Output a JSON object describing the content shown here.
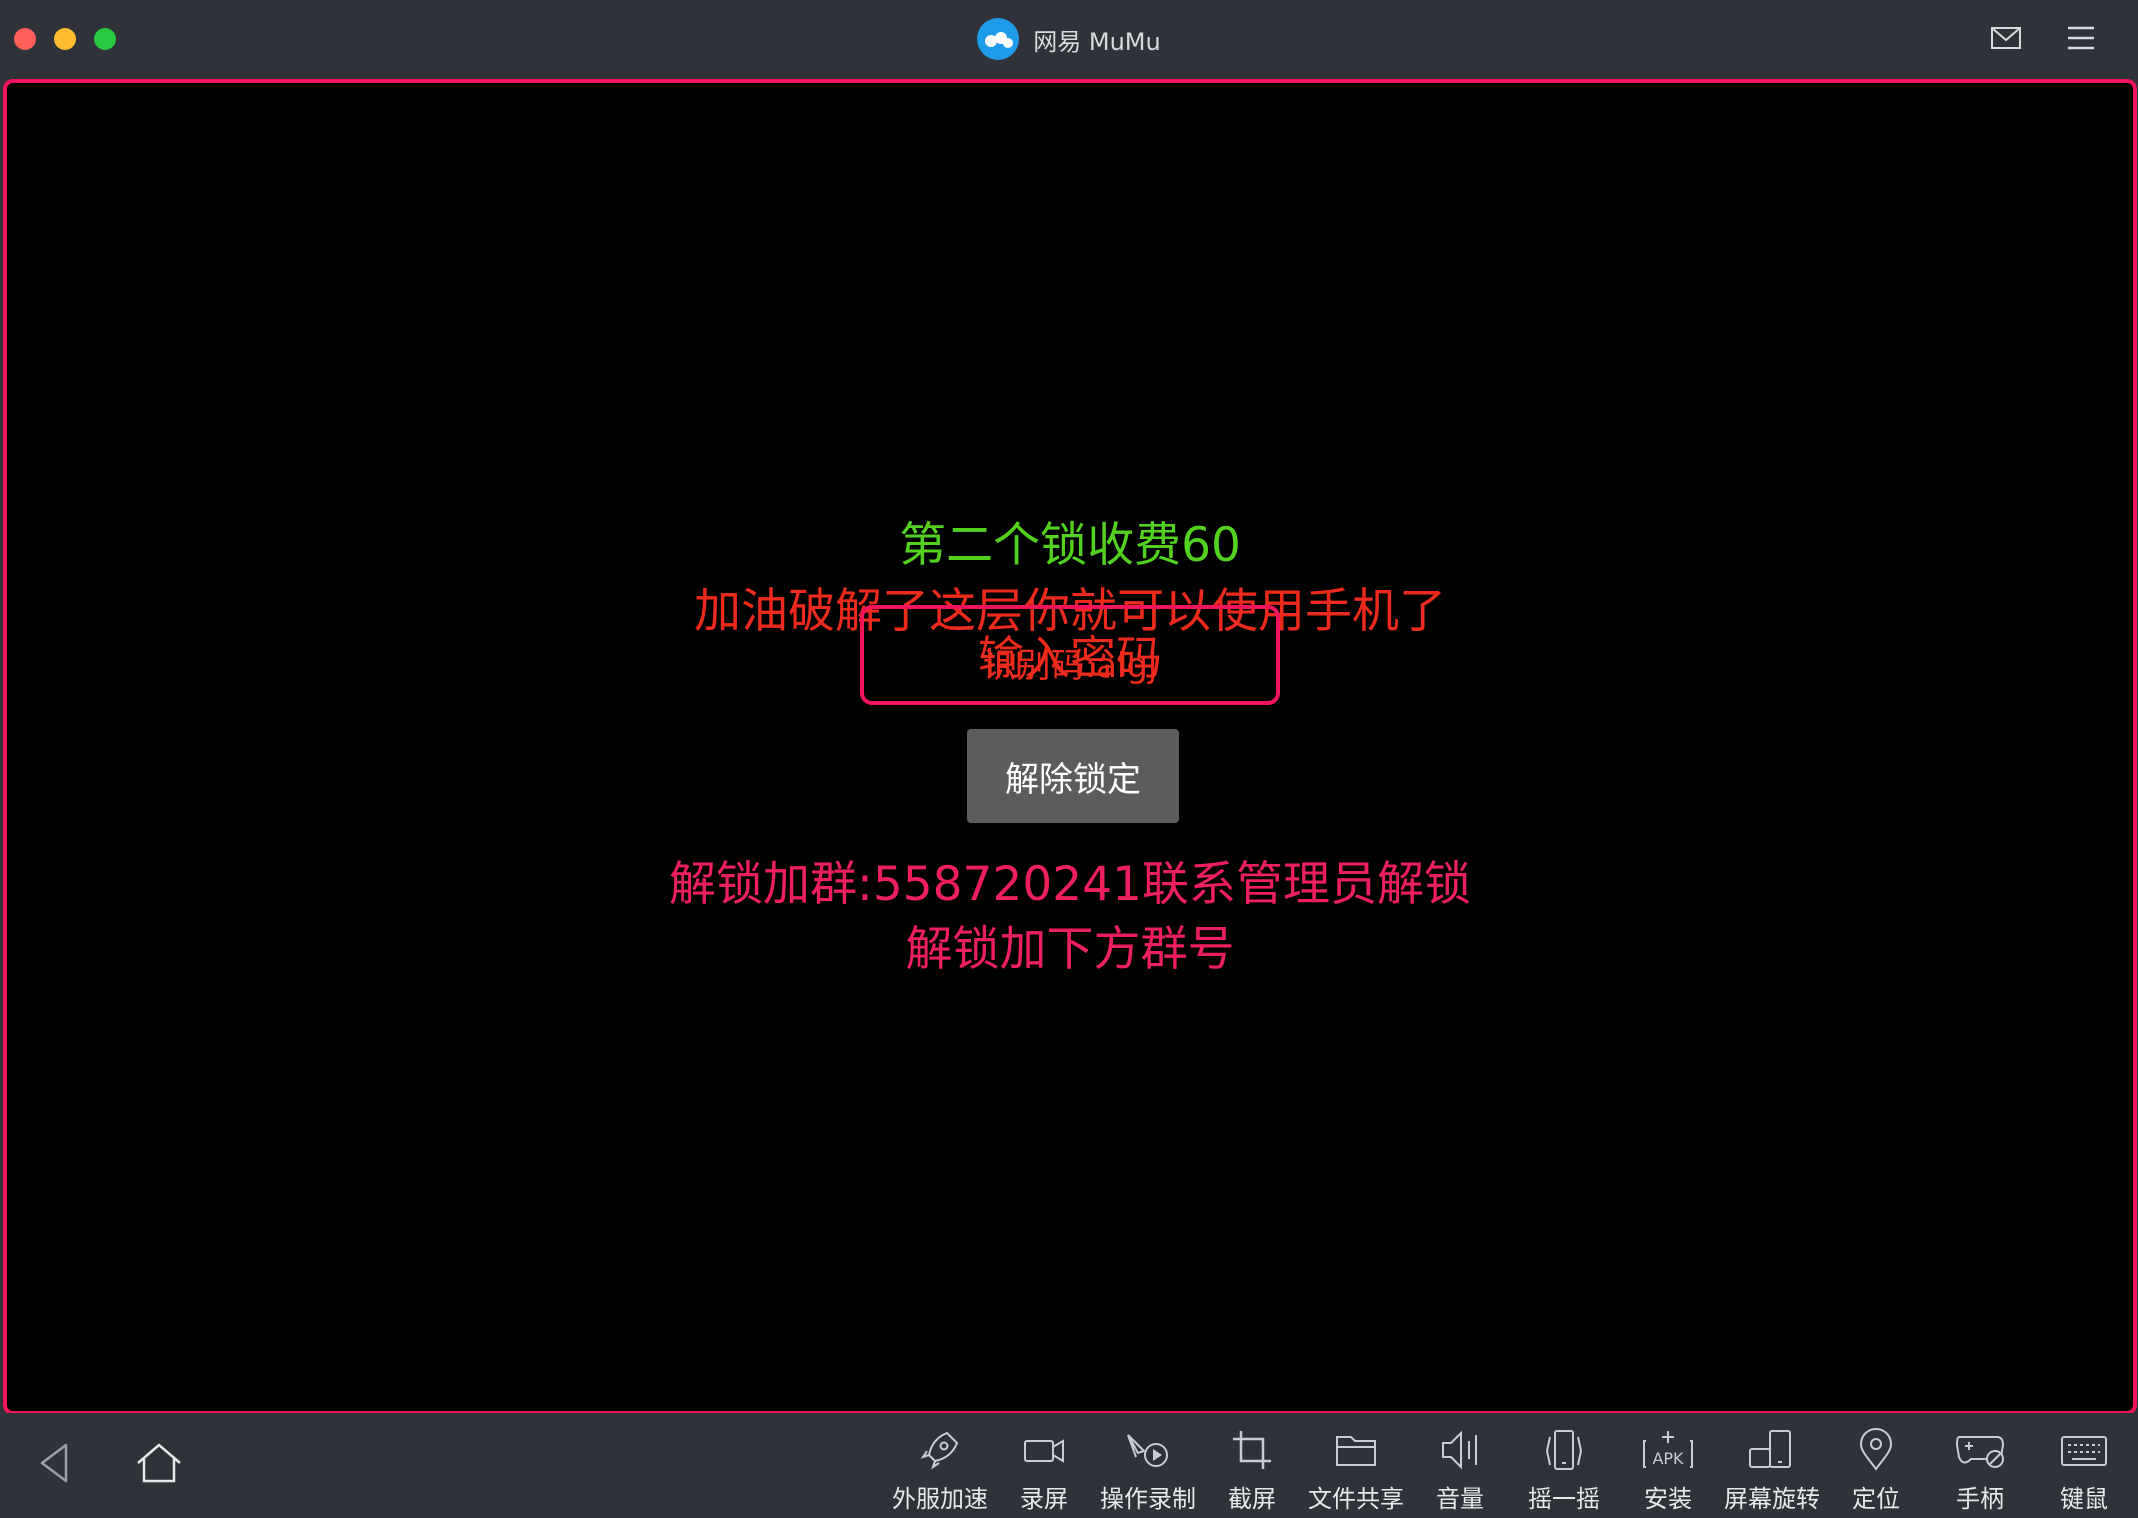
{
  "window": {
    "title": "网易 MuMu"
  },
  "screen": {
    "fee_text": "第二个锁收费60",
    "message_text": "加油破解了这层你就可以使用手机了",
    "id_code_text": "识别码:aigj",
    "password_placeholder": "输入密码",
    "unlock_button": "解除锁定",
    "group_text": "解锁加群:558720241联系管理员解锁",
    "group_text2": "解锁加下方群号"
  },
  "toolbar": {
    "items": [
      {
        "label": "外服加速",
        "icon": "rocket-icon"
      },
      {
        "label": "录屏",
        "icon": "video-camera-icon"
      },
      {
        "label": "操作录制",
        "icon": "macro-record-icon"
      },
      {
        "label": "截屏",
        "icon": "crop-icon"
      },
      {
        "label": "文件共享",
        "icon": "folder-icon"
      },
      {
        "label": "音量",
        "icon": "volume-icon"
      },
      {
        "label": "摇一摇",
        "icon": "shake-icon"
      },
      {
        "label": "安装",
        "icon": "apk-install-icon"
      },
      {
        "label": "屏幕旋转",
        "icon": "rotate-screen-icon"
      },
      {
        "label": "定位",
        "icon": "location-pin-icon"
      },
      {
        "label": "手柄",
        "icon": "gamepad-icon"
      },
      {
        "label": "键鼠",
        "icon": "keyboard-icon"
      }
    ]
  },
  "colors": {
    "frame": "#2f3238",
    "screen_border": "#f0145a",
    "fee_green": "#52d21e",
    "message_red": "#ee2a1c",
    "group_pink": "#ee1f5e",
    "unlock_button_bg": "#5c5c5c"
  }
}
